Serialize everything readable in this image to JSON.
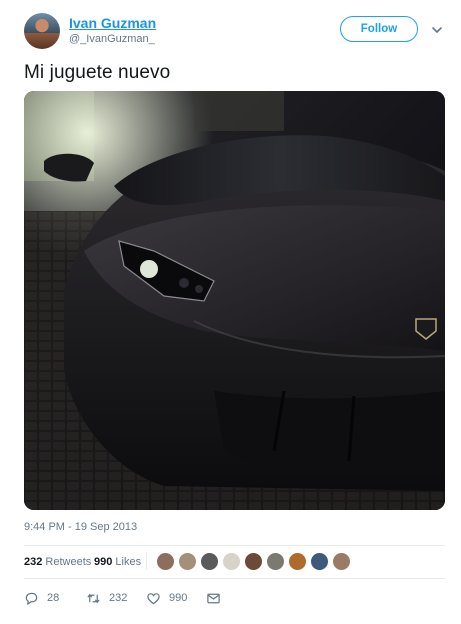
{
  "user": {
    "name": "Ivan Guzman",
    "handle": "@_IvanGuzman_"
  },
  "follow_label": "Follow",
  "tweet_text": "Mi juguete nuevo",
  "timestamp": "9:44 PM - 19 Sep 2013",
  "stats": {
    "retweets_count": "232",
    "retweets_label": "Retweets",
    "likes_count": "990",
    "likes_label": "Likes"
  },
  "actions": {
    "replies": "28",
    "retweets": "232",
    "likes": "990"
  },
  "colors": {
    "accent": "#1da1f2",
    "link": "#1b95e0",
    "muted": "#657786"
  }
}
